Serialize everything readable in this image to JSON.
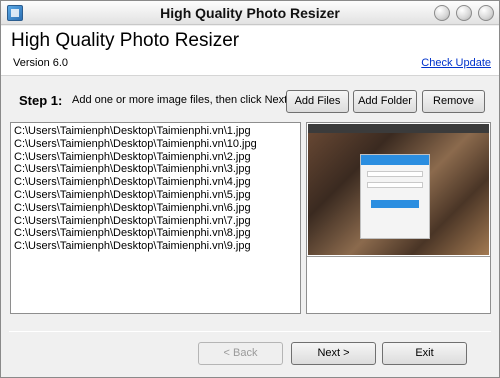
{
  "window": {
    "title": "High Quality Photo Resizer"
  },
  "header": {
    "app_title": "High Quality Photo Resizer",
    "version": "Version 6.0",
    "check_update": "Check Update"
  },
  "step": {
    "label": "Step 1:",
    "instruction": "Add one or more image files, then click Next."
  },
  "toolbar": {
    "add_files": "Add Files",
    "add_folder": "Add Folder",
    "remove": "Remove"
  },
  "files": [
    "C:\\Users\\Taimienph\\Desktop\\Taimienphi.vn\\1.jpg",
    "C:\\Users\\Taimienph\\Desktop\\Taimienphi.vn\\10.jpg",
    "C:\\Users\\Taimienph\\Desktop\\Taimienphi.vn\\2.jpg",
    "C:\\Users\\Taimienph\\Desktop\\Taimienphi.vn\\3.jpg",
    "C:\\Users\\Taimienph\\Desktop\\Taimienphi.vn\\4.jpg",
    "C:\\Users\\Taimienph\\Desktop\\Taimienphi.vn\\5.jpg",
    "C:\\Users\\Taimienph\\Desktop\\Taimienphi.vn\\6.jpg",
    "C:\\Users\\Taimienph\\Desktop\\Taimienphi.vn\\7.jpg",
    "C:\\Users\\Taimienph\\Desktop\\Taimienphi.vn\\8.jpg",
    "C:\\Users\\Taimienph\\Desktop\\Taimienphi.vn\\9.jpg"
  ],
  "navigation": {
    "back": "< Back",
    "next": "Next >",
    "exit": "Exit"
  },
  "colors": {
    "link": "#0033cc",
    "accent": "#2b8ee0"
  }
}
